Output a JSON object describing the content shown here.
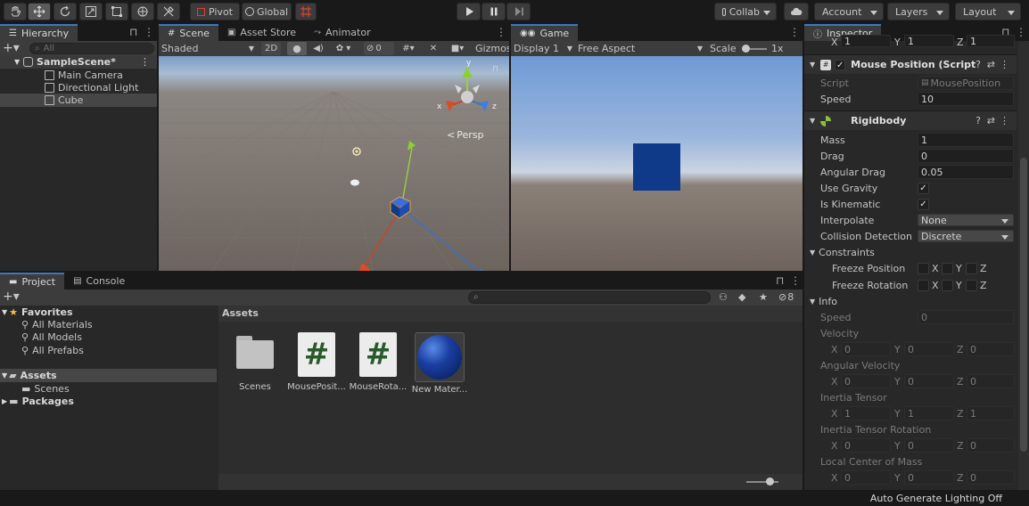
{
  "toolbar": {
    "tools": [
      "hand-tool",
      "move-tool",
      "rotate-tool",
      "scale-tool",
      "rect-tool",
      "transform-tool",
      "custom-tool"
    ],
    "pivot_label": "Pivot",
    "global_label": "Global",
    "collab_label": "Collab",
    "account_label": "Account",
    "layers_label": "Layers",
    "layout_label": "Layout"
  },
  "hierarchy": {
    "tab": "Hierarchy",
    "search_placeholder": "All",
    "scene": "SampleScene*",
    "items": [
      "Main Camera",
      "Directional Light",
      "Cube"
    ]
  },
  "scene": {
    "tabs": [
      "Scene",
      "Asset Store",
      "Animator"
    ],
    "shading": "Shaded",
    "mode_2d": "2D",
    "hidden_count": "0",
    "gizmos": "Gizmos",
    "persp": "Persp",
    "axes": {
      "x": "x",
      "y": "y",
      "z": "z"
    }
  },
  "game": {
    "tab": "Game",
    "display": "Display 1",
    "aspect": "Free Aspect",
    "scale_label": "Scale",
    "scale_value": "1x"
  },
  "inspector": {
    "tab": "Inspector",
    "transform_scale": {
      "x": "1",
      "y": "1",
      "z": "1"
    },
    "mouse_position": {
      "title": "Mouse Position (Script",
      "script_label": "Script",
      "script_value": "MousePosition",
      "speed_label": "Speed",
      "speed_value": "10"
    },
    "rigidbody": {
      "title": "Rigidbody",
      "mass_label": "Mass",
      "mass": "1",
      "drag_label": "Drag",
      "drag": "0",
      "angular_drag_label": "Angular Drag",
      "angular_drag": "0.05",
      "use_gravity_label": "Use Gravity",
      "is_kinematic_label": "Is Kinematic",
      "interpolate_label": "Interpolate",
      "interpolate": "None",
      "collision_label": "Collision Detection",
      "collision": "Discrete",
      "constraints_label": "Constraints",
      "freeze_position_label": "Freeze Position",
      "freeze_rotation_label": "Freeze Rotation",
      "xyz": {
        "x": "X",
        "y": "Y",
        "z": "Z"
      }
    },
    "info": {
      "title": "Info",
      "speed_label": "Speed",
      "speed": "0",
      "velocity_label": "Velocity",
      "velocity": {
        "x": "0",
        "y": "0",
        "z": "0"
      },
      "angular_velocity_label": "Angular Velocity",
      "angular_velocity": {
        "x": "0",
        "y": "0",
        "z": "0"
      },
      "inertia_tensor_label": "Inertia Tensor",
      "inertia_tensor": {
        "x": "1",
        "y": "1",
        "z": "1"
      },
      "inertia_rotation_label": "Inertia Tensor Rotation",
      "inertia_rotation": {
        "x": "0",
        "y": "0",
        "z": "0"
      },
      "center_of_mass_label": "Local Center of Mass",
      "center_of_mass": {
        "x": "0",
        "y": "0",
        "z": "0"
      }
    }
  },
  "project": {
    "tabs": [
      "Project",
      "Console"
    ],
    "hidden_count": "8",
    "favorites_label": "Favorites",
    "favorites": [
      "All Materials",
      "All Models",
      "All Prefabs"
    ],
    "assets_label": "Assets",
    "assets_children": [
      "Scenes"
    ],
    "packages_label": "Packages",
    "breadcrumb": "Assets",
    "asset_items": [
      "Scenes",
      "MousePosit...",
      "MouseRota...",
      "New Mater..."
    ]
  },
  "status": {
    "text": "Auto Generate Lighting Off"
  },
  "colors": {
    "accent": "#3a79bb",
    "cube_blue": "#0f3a8a",
    "sky_top": "#6f9ad6",
    "ground": "#6e645d"
  }
}
